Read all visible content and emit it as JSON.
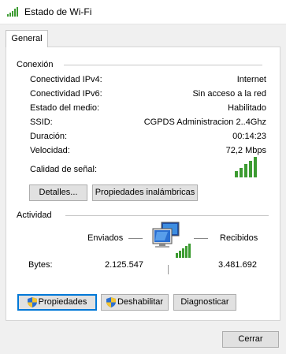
{
  "window": {
    "title": "Estado de Wi-Fi"
  },
  "tabs": [
    {
      "label": "General",
      "selected": true
    }
  ],
  "connection": {
    "section_label": "Conexión",
    "rows": [
      {
        "label": "Conectividad IPv4:",
        "value": "Internet"
      },
      {
        "label": "Conectividad IPv6:",
        "value": "Sin acceso a la red"
      },
      {
        "label": "Estado del medio:",
        "value": "Habilitado"
      },
      {
        "label": "SSID:",
        "value": "CGPDS Administracion 2..4Ghz"
      },
      {
        "label": "Duración:",
        "value": "00:14:23"
      },
      {
        "label": "Velocidad:",
        "value": "72,2 Mbps"
      }
    ],
    "signal_label": "Calidad de señal:",
    "signal_bars": 5,
    "signal_color": "#3c9b31",
    "details_button": "Detalles...",
    "wireless_props_button": "Propiedades inalámbricas"
  },
  "activity": {
    "section_label": "Actividad",
    "sent_label": "Enviados",
    "received_label": "Recibidos",
    "bytes_label": "Bytes:",
    "bytes_sent": "2.125.547",
    "bytes_received": "3.481.692",
    "icon": "network-computers-icon"
  },
  "actions": {
    "properties_button": "Propiedades",
    "disable_button": "Deshabilitar",
    "diagnose_button": "Diagnosticar",
    "close_button": "Cerrar"
  },
  "colors": {
    "focus_border": "#0078d7",
    "button_face": "#e1e1e1",
    "shield_blue": "#2c6fd1",
    "shield_yellow": "#f4c430"
  }
}
